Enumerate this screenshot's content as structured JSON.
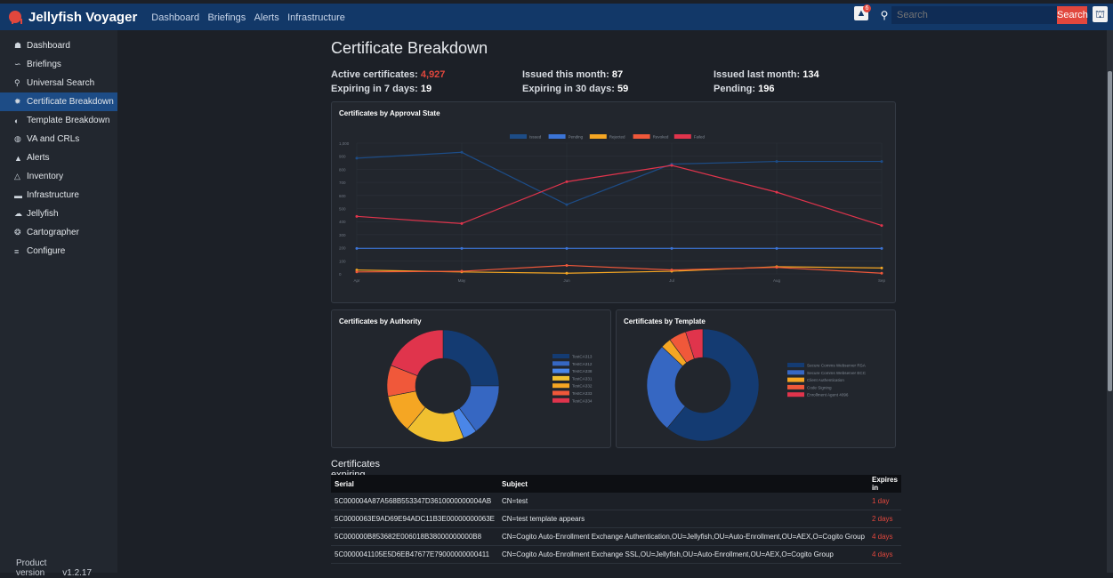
{
  "header": {
    "app_title": "Jellyfish Voyager",
    "nav": [
      "Dashboard",
      "Briefings",
      "Alerts",
      "Infrastructure"
    ],
    "notification_count": "6",
    "search_placeholder": "Search",
    "search_button": "Search"
  },
  "sidebar": {
    "items": [
      {
        "label": "Dashboard",
        "icon": "home-icon",
        "active": false
      },
      {
        "label": "Briefings",
        "icon": "line-chart-icon",
        "active": false
      },
      {
        "label": "Universal Search",
        "icon": "search-icon",
        "active": false
      },
      {
        "label": "Certificate Breakdown",
        "icon": "certificate-icon",
        "active": true
      },
      {
        "label": "Template Breakdown",
        "icon": "template-icon",
        "active": false
      },
      {
        "label": "VA and CRLs",
        "icon": "shield-icon",
        "active": false
      },
      {
        "label": "Alerts",
        "icon": "bell-icon",
        "active": false
      },
      {
        "label": "Inventory",
        "icon": "inventory-icon",
        "active": false
      },
      {
        "label": "Infrastructure",
        "icon": "server-icon",
        "active": false
      },
      {
        "label": "Jellyfish",
        "icon": "cloud-icon",
        "active": false
      },
      {
        "label": "Cartographer",
        "icon": "compass-icon",
        "active": false
      },
      {
        "label": "Configure",
        "icon": "sliders-icon",
        "active": false
      }
    ],
    "product_version_label": "Product version",
    "product_version": "v1.2.17"
  },
  "page": {
    "title": "Certificate Breakdown",
    "stats": {
      "active_label": "Active certificates: ",
      "active_value": "4,927",
      "issued_month_label": "Issued this month: ",
      "issued_month_value": "87",
      "issued_last_label": "Issued last month: ",
      "issued_last_value": "134",
      "expiring7_label": "Expiring in 7 days: ",
      "expiring7_value": "19",
      "expiring30_label": "Expiring in 30 days: ",
      "expiring30_value": "59",
      "pending_label": "Pending: ",
      "pending_value": "196"
    }
  },
  "chart_data": [
    {
      "type": "line",
      "title": "Certificates by Approval State",
      "categories": [
        "Apr",
        "May",
        "Jun",
        "Jul",
        "Aug",
        "Sep"
      ],
      "ylim": [
        0,
        1000
      ],
      "yticks": [
        "0",
        "100",
        "200",
        "300",
        "400",
        "500",
        "600",
        "700",
        "800",
        "900",
        "1,000"
      ],
      "legend_position": "top",
      "series": [
        {
          "name": "Issued",
          "color": "#1d4c86",
          "values": [
            885,
            930,
            530,
            840,
            860,
            860
          ]
        },
        {
          "name": "Pending",
          "color": "#3b74d6",
          "values": [
            195,
            195,
            195,
            195,
            195,
            195
          ]
        },
        {
          "name": "Rejected",
          "color": "#f5a623",
          "values": [
            30,
            15,
            5,
            20,
            55,
            45
          ]
        },
        {
          "name": "Revoked",
          "color": "#f0583a",
          "values": [
            15,
            20,
            65,
            30,
            50,
            5
          ]
        },
        {
          "name": "Failed",
          "color": "#e0344c",
          "values": [
            440,
            385,
            705,
            830,
            625,
            370
          ]
        }
      ]
    },
    {
      "type": "pie",
      "title": "Certificates by Authority",
      "labels": [
        "TestCA313",
        "TestCA312",
        "TestCA338",
        "TestCA331",
        "TestCA332",
        "TestCA333",
        "TestCA334"
      ],
      "values": [
        25,
        15,
        4,
        17,
        11,
        9,
        19
      ],
      "colors": [
        "#143b72",
        "#3667c2",
        "#4a86e8",
        "#f0c030",
        "#f5a623",
        "#f0583a",
        "#e0344c"
      ],
      "legend_position": "right"
    },
    {
      "type": "pie",
      "title": "Certificates by Template",
      "labels": [
        "Secure Comms Webserver RSA",
        "Secure Comms Webserver ECC",
        "Client Authentication",
        "Code Signing",
        "Enrollment Agent 4096"
      ],
      "values": [
        61,
        26,
        3,
        5,
        5
      ],
      "colors": [
        "#143b72",
        "#3667c2",
        "#f5a623",
        "#f0583a",
        "#e0344c"
      ],
      "legend_position": "right"
    }
  ],
  "expiring": {
    "title": "Certificates expiring soon",
    "headers": {
      "serial": "Serial",
      "subject": "Subject",
      "expires": "Expires in"
    },
    "rows": [
      {
        "serial": "5C000004A87A568B553347D3610000000004AB",
        "subject": "CN=test",
        "expires": "1 day"
      },
      {
        "serial": "5C0000063E9AD69E94ADC11B3E00000000063E",
        "subject": "CN=test template appears",
        "expires": "2 days"
      },
      {
        "serial": "5C000000B853682E006018B38000000000B8",
        "subject": "CN=Cogito Auto-Enrollment Exchange Authentication,OU=Jellyfish,OU=Auto-Enrollment,OU=AEX,O=Cogito Group",
        "expires": "4 days"
      },
      {
        "serial": "5C0000041105E5D6EB47677E79000000000411",
        "subject": "CN=Cogito Auto-Enrollment Exchange SSL,OU=Jellyfish,OU=Auto-Enrollment,OU=AEX,O=Cogito Group",
        "expires": "4 days"
      }
    ]
  }
}
